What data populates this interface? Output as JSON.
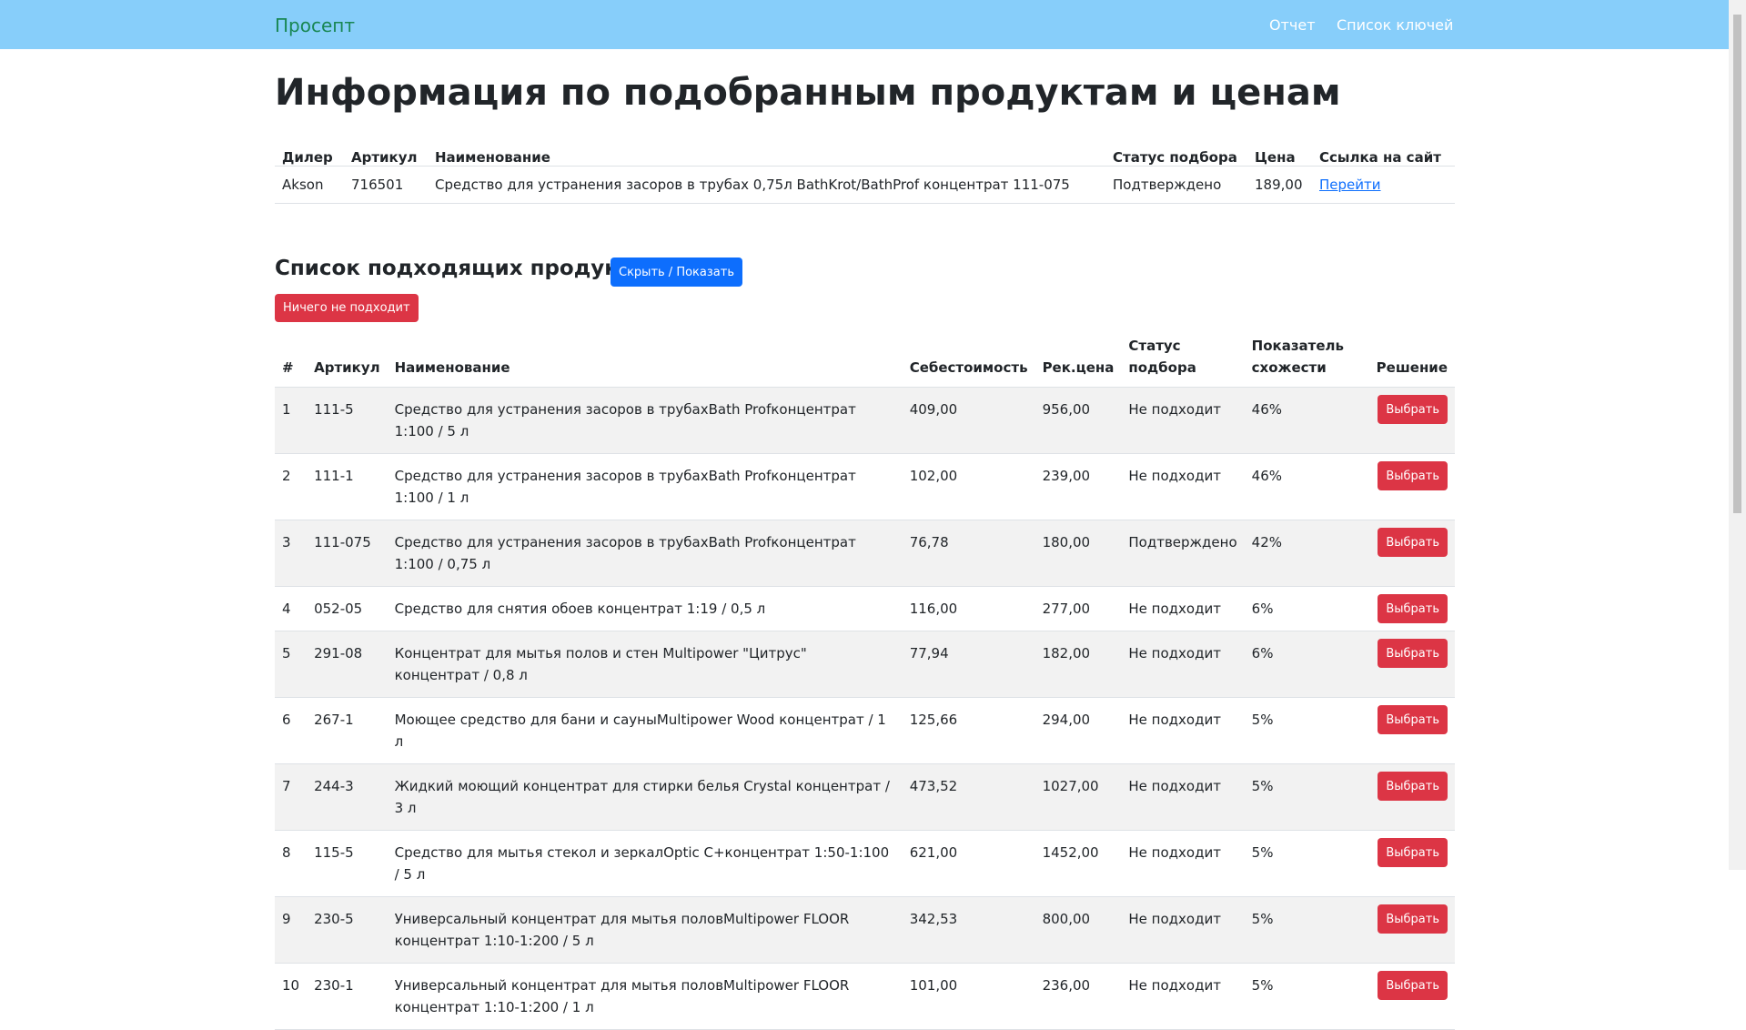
{
  "navbar": {
    "brand": "Просепт",
    "report": "Отчет",
    "keys": "Список ключей"
  },
  "page_title": "Информация по подобранным продуктам и ценам",
  "dealer_table": {
    "headers": [
      "Дилер",
      "Артикул",
      "Наименование",
      "Статус подбора",
      "Цена",
      "Ссылка на сайт"
    ],
    "row": {
      "dealer": "Akson",
      "article": "716501",
      "name": "Средство для устранения засоров в трубах 0,75л BathKrot/BathProf концентрат 111-075",
      "status": "Подтверждено",
      "price": "189,00",
      "link": "Перейти"
    }
  },
  "products_section": {
    "title": "Список подходящих продуктов:",
    "toggle_label": "Скрыть / Показать",
    "none_label": "Ничего не подходит",
    "headers": [
      "#",
      "Артикул",
      "Наименование",
      "Себестоимость",
      "Рек.цена",
      "Статус подбора",
      "Показатель схожести",
      "Решение"
    ],
    "choose_label": "Выбрать",
    "rows": [
      {
        "num": "1",
        "article": "111-5",
        "name": "Средство для устранения засоров в трубахBath Profконцентрат 1:100 / 5 л",
        "cost": "409,00",
        "price": "956,00",
        "status": "Не подходит",
        "similarity": "46%"
      },
      {
        "num": "2",
        "article": "111-1",
        "name": "Средство для устранения засоров в трубахBath Profконцентрат 1:100 / 1 л",
        "cost": "102,00",
        "price": "239,00",
        "status": "Не подходит",
        "similarity": "46%"
      },
      {
        "num": "3",
        "article": "111-075",
        "name": "Средство для устранения засоров в трубахBath Profконцентрат 1:100 / 0,75 л",
        "cost": "76,78",
        "price": "180,00",
        "status": "Подтверждено",
        "similarity": "42%"
      },
      {
        "num": "4",
        "article": "052-05",
        "name": "Средство для снятия обоев концентрат 1:19 / 0,5 л",
        "cost": "116,00",
        "price": "277,00",
        "status": "Не подходит",
        "similarity": "6%"
      },
      {
        "num": "5",
        "article": "291-08",
        "name": "Концентрат для мытья полов и стен Multipower \"Цитрус\" концентрат / 0,8 л",
        "cost": "77,94",
        "price": "182,00",
        "status": "Не подходит",
        "similarity": "6%"
      },
      {
        "num": "6",
        "article": "267-1",
        "name": "Моющее средство для бани и сауныMultipower Wood концентрат / 1 л",
        "cost": "125,66",
        "price": "294,00",
        "status": "Не подходит",
        "similarity": "5%"
      },
      {
        "num": "7",
        "article": "244-3",
        "name": "Жидкий моющий концентрат для стирки белья Crystal концентрат / 3 л",
        "cost": "473,52",
        "price": "1027,00",
        "status": "Не подходит",
        "similarity": "5%"
      },
      {
        "num": "8",
        "article": "115-5",
        "name": "Средство для мытья стекол и зеркалOptic C+концентрат 1:50-1:100 / 5 л",
        "cost": "621,00",
        "price": "1452,00",
        "status": "Не подходит",
        "similarity": "5%"
      },
      {
        "num": "9",
        "article": "230-5",
        "name": "Универсальный концентрат для мытья половMultipower FLOOR концентрат 1:10-1:200 / 5 л",
        "cost": "342,53",
        "price": "800,00",
        "status": "Не подходит",
        "similarity": "5%"
      },
      {
        "num": "10",
        "article": "230-1",
        "name": "Универсальный концентрат для мытья половMultipower FLOOR концентрат 1:10-1:200 / 1 л",
        "cost": "101,00",
        "price": "236,00",
        "status": "Не подходит",
        "similarity": "5%"
      }
    ]
  },
  "colors": {
    "navbar": "#87cefa",
    "brand": "#198754",
    "primary": "#0d6efd",
    "danger": "#dc3545"
  }
}
